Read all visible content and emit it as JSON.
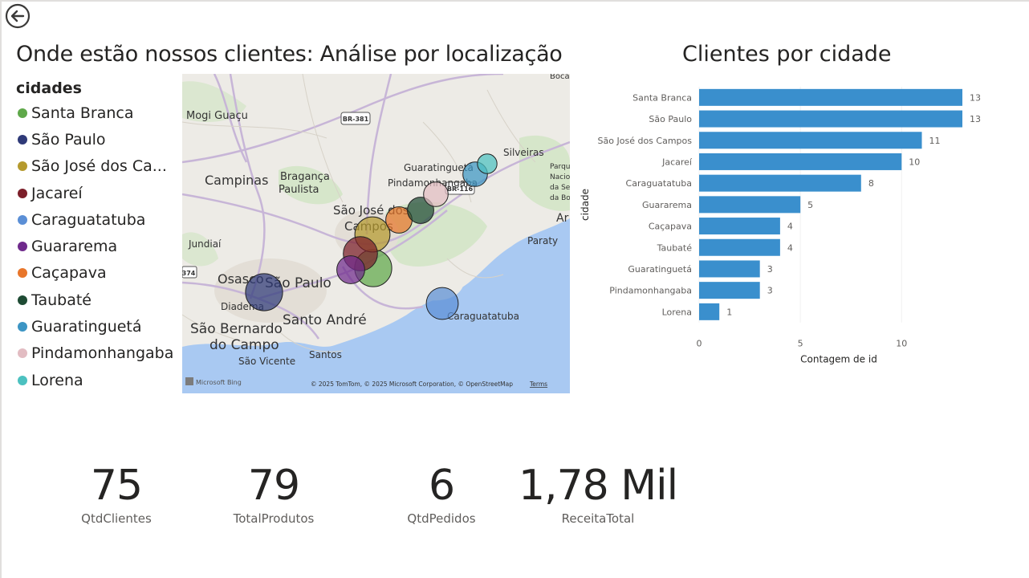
{
  "report": {
    "title_left": "Onde estão nossos clientes: Análise por localização",
    "title_right": "Clientes por cidade"
  },
  "icons": {
    "back": "back-arrow-icon"
  },
  "legend": {
    "title": "cidades",
    "items": [
      {
        "label": "Santa Branca",
        "color": "#5fa84a"
      },
      {
        "label": "São Paulo",
        "color": "#2f3a78"
      },
      {
        "label": "São José dos Ca...",
        "color": "#b59a2e"
      },
      {
        "label": "Jacareí",
        "color": "#7c1f2a"
      },
      {
        "label": "Caraguatatuba",
        "color": "#5b8fd6"
      },
      {
        "label": "Guararema",
        "color": "#6f2a8c"
      },
      {
        "label": "Caçapava",
        "color": "#e8762b"
      },
      {
        "label": "Taubaté",
        "color": "#1e4b34"
      },
      {
        "label": "Guaratinguetá",
        "color": "#3c95c4"
      },
      {
        "label": "Pindamonhangaba",
        "color": "#e2bcc2"
      },
      {
        "label": "Lorena",
        "color": "#4cc1c0"
      }
    ]
  },
  "map": {
    "places": [
      "Mogi Guaçu",
      "Campinas",
      "Bragança",
      "Paulista",
      "Jundiaí",
      "Osasco",
      "São Paulo",
      "Diadema",
      "Santo André",
      "São Bernardo",
      "do Campo",
      "São Vicente",
      "Santos",
      "São José dos",
      "Campos",
      "Pindamonhangaba",
      "Guaratinguetá",
      "Silveiras",
      "Caraguatatuba",
      "Paraty",
      "Ar",
      "Bocai",
      "Parque",
      "Nacio",
      "da Se",
      "da Boc"
    ],
    "roads": [
      "BR-381",
      "BR-116",
      "374"
    ],
    "attribution": "© 2025 TomTom, © 2025 Microsoft Corporation, © OpenStreetMap",
    "terms": "Terms",
    "logo": "Microsoft Bing"
  },
  "chart_data": {
    "type": "bar",
    "orientation": "horizontal",
    "categories": [
      "Santa Branca",
      "São Paulo",
      "São José dos Campos",
      "Jacareí",
      "Caraguatatuba",
      "Guararema",
      "Caçapava",
      "Taubaté",
      "Guaratinguetá",
      "Pindamonhangaba",
      "Lorena"
    ],
    "values": [
      13,
      13,
      11,
      10,
      8,
      5,
      4,
      4,
      3,
      3,
      1
    ],
    "xlabel": "Contagem de id",
    "ylabel": "cidade",
    "xticks": [
      0,
      5,
      10
    ],
    "xlim": [
      0,
      13
    ],
    "bar_color": "#3a8fcd",
    "data_labels": true
  },
  "kpis": [
    {
      "value": "75",
      "label": "QtdClientes"
    },
    {
      "value": "79",
      "label": "TotalProdutos"
    },
    {
      "value": "6",
      "label": "QtdPedidos"
    },
    {
      "value": "1,78 Mil",
      "label": "ReceitaTotal"
    }
  ]
}
